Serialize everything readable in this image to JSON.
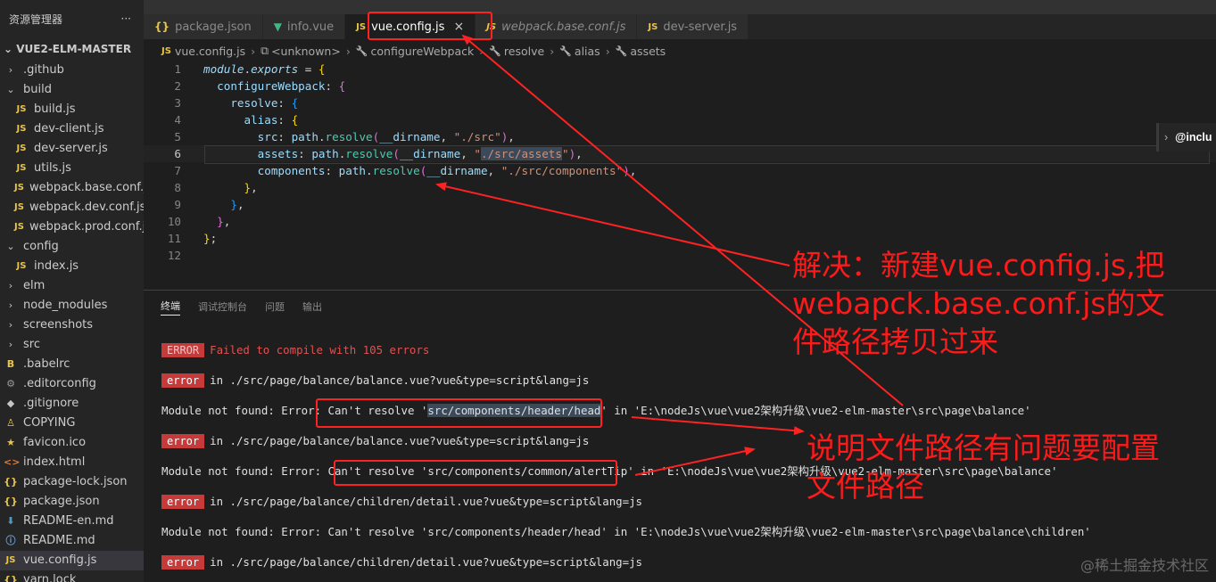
{
  "sidebar": {
    "title": "资源管理器",
    "more_icon": "ellipsis-icon",
    "root": "VUE2-ELM-MASTER",
    "items": [
      {
        "label": ".github",
        "icon": "chevron-right",
        "indent": 1
      },
      {
        "label": "build",
        "icon": "chevron-down",
        "indent": 1
      },
      {
        "label": "build.js",
        "icon": "js",
        "indent": 2
      },
      {
        "label": "dev-client.js",
        "icon": "js",
        "indent": 2
      },
      {
        "label": "dev-server.js",
        "icon": "js",
        "indent": 2
      },
      {
        "label": "utils.js",
        "icon": "js",
        "indent": 2
      },
      {
        "label": "webpack.base.conf.js",
        "icon": "js",
        "indent": 2
      },
      {
        "label": "webpack.dev.conf.js",
        "icon": "js",
        "indent": 2
      },
      {
        "label": "webpack.prod.conf.js",
        "icon": "js",
        "indent": 2
      },
      {
        "label": "config",
        "icon": "chevron-down",
        "indent": 1
      },
      {
        "label": "index.js",
        "icon": "js",
        "indent": 2
      },
      {
        "label": "elm",
        "icon": "chevron-right",
        "indent": 1
      },
      {
        "label": "node_modules",
        "icon": "chevron-right",
        "indent": 1
      },
      {
        "label": "screenshots",
        "icon": "chevron-right",
        "indent": 1
      },
      {
        "label": "src",
        "icon": "chevron-right",
        "indent": 1
      },
      {
        "label": ".babelrc",
        "icon": "babel",
        "indent": 1
      },
      {
        "label": ".editorconfig",
        "icon": "gear",
        "indent": 1
      },
      {
        "label": ".gitignore",
        "icon": "git",
        "indent": 1
      },
      {
        "label": "COPYING",
        "icon": "person",
        "indent": 1
      },
      {
        "label": "favicon.ico",
        "icon": "star",
        "indent": 1
      },
      {
        "label": "index.html",
        "icon": "html",
        "indent": 1
      },
      {
        "label": "package-lock.json",
        "icon": "brace",
        "indent": 1
      },
      {
        "label": "package.json",
        "icon": "brace",
        "indent": 1
      },
      {
        "label": "README-en.md",
        "icon": "md",
        "indent": 1
      },
      {
        "label": "README.md",
        "icon": "info",
        "indent": 1
      },
      {
        "label": "vue.config.js",
        "icon": "js",
        "indent": 1,
        "active": true
      },
      {
        "label": "yarn.lock",
        "icon": "brace",
        "indent": 1
      }
    ]
  },
  "tabs": [
    {
      "label": "package.json",
      "icon": "brace"
    },
    {
      "label": "info.vue",
      "icon": "vue"
    },
    {
      "label": "vue.config.js",
      "icon": "js",
      "active": true,
      "close": "×"
    },
    {
      "label": "webpack.base.conf.js",
      "icon": "js",
      "italic": true
    },
    {
      "label": "dev-server.js",
      "icon": "js"
    }
  ],
  "breadcrumb": {
    "items": [
      "vue.config.js",
      "<unknown>",
      "configureWebpack",
      "resolve",
      "alias",
      "assets"
    ]
  },
  "editor": {
    "current_line": 6,
    "line_numbers": [
      "1",
      "2",
      "3",
      "4",
      "5",
      "6",
      "7",
      "8",
      "9",
      "10",
      "11",
      "12"
    ],
    "peek_label": "@inclu"
  },
  "panel": {
    "tabs": [
      "终端",
      "调试控制台",
      "问题",
      "输出"
    ],
    "terminal": {
      "first_badge": "ERROR",
      "first_message": "Failed to compile with 105 errors",
      "lines": [
        {
          "badge": "error",
          "text": "in ./src/page/balance/balance.vue?vue&type=script&lang=js"
        },
        {
          "prefix": "Module not found: Error: Can't resolve '",
          "path": "src/components/header/head",
          "suffix": "' in 'E:\\nodeJs\\vue\\vue2架构升级\\vue2-elm-master\\src\\page\\balance'"
        },
        {
          "badge": "error",
          "text": "in ./src/page/balance/balance.vue?vue&type=script&lang=js"
        },
        {
          "prefix": "Module not found: Error: Can't resolve '",
          "path": "src/components/common/alertTip",
          "suffix": "' in 'E:\\nodeJs\\vue\\vue2架构升级\\vue2-elm-master\\src\\page\\balance'"
        },
        {
          "badge": "error",
          "text": "in ./src/page/balance/children/detail.vue?vue&type=script&lang=js"
        },
        {
          "prefix": "Module not found: Error: Can't resolve '",
          "path": "src/components/header/head",
          "suffix": "' in 'E:\\nodeJs\\vue\\vue2架构升级\\vue2-elm-master\\src\\page\\balance\\children'"
        },
        {
          "badge": "error",
          "text": "in ./src/page/balance/children/detail.vue?vue&type=script&lang=js"
        }
      ]
    }
  },
  "annotations": {
    "note1_lines": [
      "解决：新建vue.config.js,把",
      "webapck.base.conf.js的文",
      "件路径拷贝过来"
    ],
    "note2_lines": [
      "说明文件路径有问题要配置",
      "文件路径"
    ],
    "color": "#ff2222"
  },
  "watermark": "@稀土掘金技术社区"
}
